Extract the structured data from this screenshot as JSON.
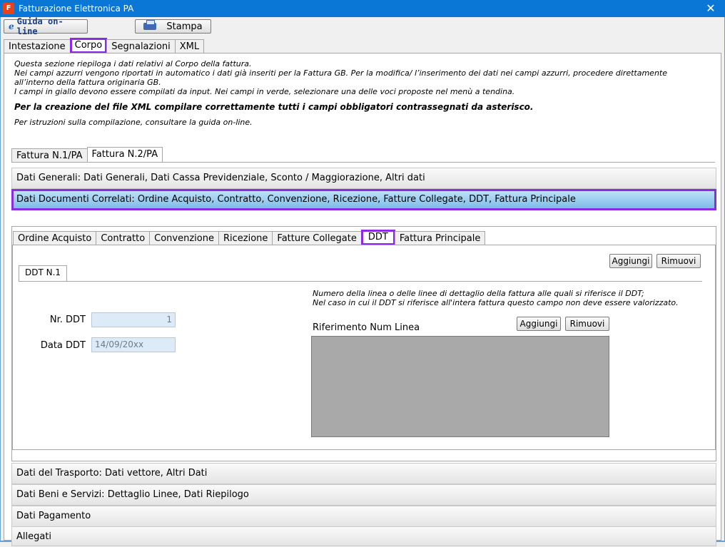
{
  "window": {
    "title": "Fatturazione Elettronica PA",
    "app_icon_letter": "F"
  },
  "toolbar": {
    "guida_label": "Guida on-line",
    "stampa_label": "Stampa"
  },
  "main_tabs": [
    "Intestazione",
    "Corpo",
    "Segnalazioni",
    "XML"
  ],
  "info": {
    "line1": "Questa sezione riepiloga i dati relativi al Corpo della fattura.",
    "line2": "Nei campi azzurri vengono riportati in automatico i dati già inseriti per la Fattura GB. Per la modifica/ l’inserimento dei dati nei campi azzurri, procedere direttamente all’interno della fattura originaria GB.",
    "line3": "I campi in giallo devono essere compilati da input. Nei campi in verde, selezionare una delle voci proposte nel menù a tendina.",
    "bold": "Per la creazione del file XML compilare correttamente tutti i campi obbligatori contrassegnati da asterisco.",
    "last": "Per istruzioni sulla compilazione, consultare la guida on-line."
  },
  "fattura_tabs": [
    "Fattura N.1/PA",
    "Fattura N.2/PA"
  ],
  "sections": {
    "dati_generali": "Dati Generali: Dati Generali, Dati Cassa Previdenziale, Sconto / Maggiorazione, Altri dati",
    "dati_documenti": "Dati Documenti Correlati: Ordine Acquisto, Contratto, Convenzione, Ricezione, Fatture Collegate, DDT, Fattura Principale",
    "dati_trasporto": "Dati del Trasporto: Dati vettore, Altri Dati",
    "dati_beni": "Dati Beni e Servizi: Dettaglio Linee, Dati Riepilogo",
    "dati_pagamento": "Dati Pagamento",
    "allegati": "Allegati"
  },
  "doc_tabs": [
    "Ordine Acquisto",
    "Contratto",
    "Convenzione",
    "Ricezione",
    "Fatture Collegate",
    "DDT",
    "Fattura Principale"
  ],
  "ddt": {
    "aggiungi": "Aggiungi",
    "rimuovi": "Rimuovi",
    "tab": "DDT N.1",
    "nr_label": "Nr. DDT",
    "nr_value": "1",
    "data_label": "Data DDT",
    "data_value": "14/09/20xx",
    "note1": "Numero della linea o delle linee di dettaglio della fattura alle quali si riferisce il DDT;",
    "note2": "Nel caso in cui il DDT si riferisce all'intera fattura questo campo non deve essere valorizzato.",
    "rif_label": "Riferimento Num Linea",
    "aggiungi2": "Aggiungi",
    "rimuovi2": "Rimuovi"
  },
  "colors": {
    "titlebar": "#0a77d6",
    "highlight": "#8b2be2",
    "field_blue": "#dcebf7"
  }
}
